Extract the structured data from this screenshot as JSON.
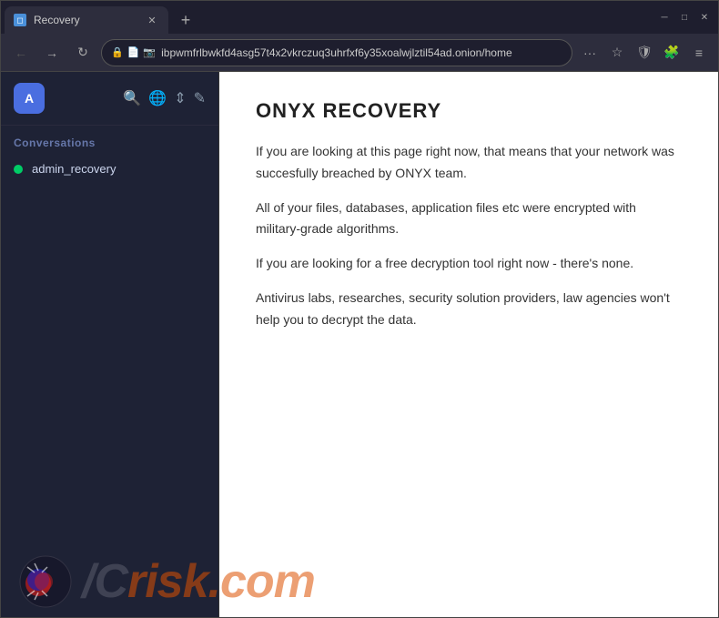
{
  "window": {
    "title": "Recovery",
    "tab_favicon": "◻",
    "new_tab": "+",
    "controls": {
      "minimize": "─",
      "maximize": "□",
      "close": "✕"
    }
  },
  "nav": {
    "back": "←",
    "forward": "→",
    "refresh": "↻",
    "url": "ibpwmfrlbwkfd4asg57t4x2vkrczuq3uhrfxf6y35xoalwjlztil54ad.onion/home",
    "more": "···",
    "bookmark": "☆",
    "shield": "🛡",
    "extensions": "🧩",
    "menu": "≡"
  },
  "sidebar": {
    "avatar_letter": "A",
    "search_icon": "🔍",
    "globe_icon": "🌐",
    "sort_icon": "≡",
    "edit_icon": "✏",
    "sections": {
      "conversations_label": "Conversations"
    },
    "conversations": [
      {
        "name": "admin_recovery",
        "status": "online"
      }
    ]
  },
  "page": {
    "title": "ONYX RECOVERY",
    "paragraphs": [
      "If you are looking at this page right now, that means that your network was succesfully breached by ONYX team.",
      "All of your files, databases, application files etc were encrypted with military-grade algorithms.",
      "If you are looking for a free decryption tool right now - there's none.",
      "Antivirus labs, researches, security solution providers, law agencies won't help you to decrypt the data."
    ]
  },
  "watermark": {
    "text_plain": "/C",
    "text_colored": "risk.com"
  }
}
